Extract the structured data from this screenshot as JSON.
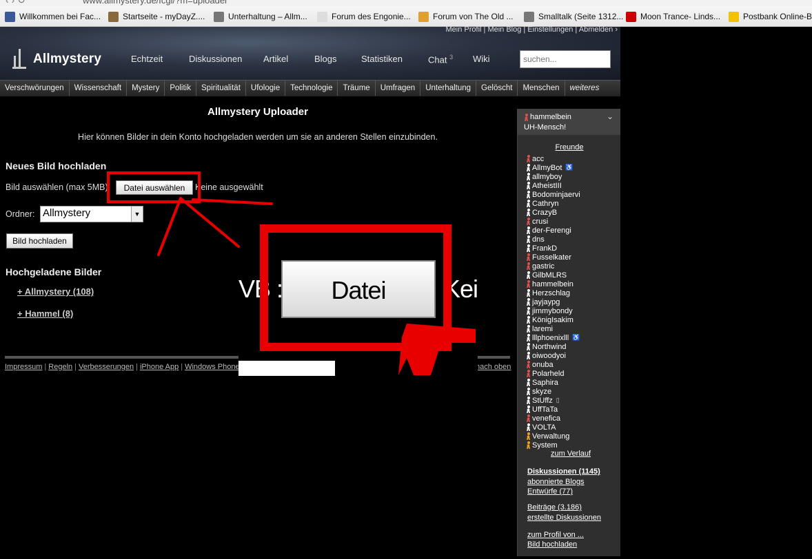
{
  "browser": {
    "url": "www.allmystery.de/fcgi/?m=uploader",
    "bookmarks": [
      {
        "label": "Willkommen bei Fac...",
        "color": "#3b5998"
      },
      {
        "label": "Startseite - myDayZ....",
        "color": "#8a6a3a"
      },
      {
        "label": "Unterhaltung – Allm...",
        "color": "#777777"
      },
      {
        "label": "Forum des Engonie...",
        "color": "#dddddd"
      },
      {
        "label": "Forum von The Old ...",
        "color": "#e0a030"
      },
      {
        "label": "Smalltalk (Seite 1312...",
        "color": "#777777"
      },
      {
        "label": "Moon Trance- Linds...",
        "color": "#cc0000"
      },
      {
        "label": "Postbank Online-B",
        "color": "#f2c200"
      }
    ]
  },
  "header": {
    "userlinks": "Mein Profil  |  Mein Blog  |  Einstellungen  |  Abmelden  ›",
    "logo": "Allmystery",
    "nav": [
      {
        "label": "Echtzeit"
      },
      {
        "label": "Diskussionen"
      },
      {
        "label": "Artikel"
      },
      {
        "label": "Blogs"
      },
      {
        "label": "Statistiken"
      },
      {
        "label": "Chat",
        "badge": "3"
      },
      {
        "label": "Wiki"
      }
    ],
    "search_placeholder": "suchen..."
  },
  "categories": [
    "Verschwörungen",
    "Wissenschaft",
    "Mystery",
    "Politik",
    "Spiritualität",
    "Ufologie",
    "Technologie",
    "Träume",
    "Umfragen",
    "Unterhaltung",
    "Gelöscht",
    "Menschen",
    "weiteres"
  ],
  "main": {
    "title": "Allmystery Uploader",
    "intro": "Hier können Bilder in dein Konto hochgeladen werden um sie an anderen Stellen einzubinden.",
    "new_image_heading": "Neues Bild hochladen",
    "choose_label": "Bild auswählen (max 5MB):",
    "choose_button": "Datei auswählen",
    "no_file": "Keine ausgewählt",
    "folder_label": "Ordner:",
    "folder_value": "Allmystery",
    "upload_button": "Bild hochladen",
    "uploaded_heading": "Hochgeladene Bilder",
    "folders": [
      "+ Allmystery (108)",
      "+ Hammel (8)"
    ]
  },
  "footer": {
    "links": [
      "Impressum",
      "Regeln",
      "Verbesserungen",
      "iPhone App",
      "Windows Phone A"
    ],
    "top_link": "nach oben"
  },
  "zoom": {
    "left_fragment": "VB :",
    "button": "Datei auswählen",
    "right_fragment": "Keine"
  },
  "sidebar": {
    "user": "hammelbein",
    "user_color": "#e05050",
    "status": "UH-Mensch!",
    "friends_title": "Freunde",
    "friends": [
      {
        "name": "acc",
        "color": "#e05050"
      },
      {
        "name": "AllmyBot",
        "color": "#ffffff",
        "extra": "♿"
      },
      {
        "name": "allmyboy",
        "color": "#ffffff"
      },
      {
        "name": "AtheistIII",
        "color": "#ffffff"
      },
      {
        "name": "Bodominjaervi",
        "color": "#ffffff"
      },
      {
        "name": "Cathryn",
        "color": "#ffffff"
      },
      {
        "name": "CrazyB",
        "color": "#ffffff"
      },
      {
        "name": "crusi",
        "color": "#e05050"
      },
      {
        "name": "der-Ferengi",
        "color": "#ffffff"
      },
      {
        "name": "dns",
        "color": "#ffffff"
      },
      {
        "name": "FrankD",
        "color": "#ffffff"
      },
      {
        "name": "Fusselkater",
        "color": "#e05050"
      },
      {
        "name": "gastric",
        "color": "#e05050"
      },
      {
        "name": "GilbMLRS",
        "color": "#ffffff"
      },
      {
        "name": "hammelbein",
        "color": "#e05050"
      },
      {
        "name": "Herzschlag",
        "color": "#ffffff"
      },
      {
        "name": "jayjaypg",
        "color": "#ffffff"
      },
      {
        "name": "jimmybondy",
        "color": "#ffffff"
      },
      {
        "name": "KönigIsakim",
        "color": "#ffffff"
      },
      {
        "name": "laremi",
        "color": "#ffffff"
      },
      {
        "name": "lllphoenixlll",
        "color": "#ffffff",
        "extra": "♿"
      },
      {
        "name": "Northwind",
        "color": "#ffffff"
      },
      {
        "name": "oiwoodyoi",
        "color": "#ffffff"
      },
      {
        "name": "onuba",
        "color": "#e05050"
      },
      {
        "name": "Polarheld",
        "color": "#e05050"
      },
      {
        "name": "Saphira",
        "color": "#ffffff"
      },
      {
        "name": "skyze",
        "color": "#ffffff"
      },
      {
        "name": "StUffz",
        "color": "#ffffff",
        "extra": "▯"
      },
      {
        "name": "UffTaTa",
        "color": "#ffffff"
      },
      {
        "name": "venefica",
        "color": "#e05050"
      },
      {
        "name": "VOLTA",
        "color": "#ffffff"
      },
      {
        "name": "Verwaltung",
        "color": "#f0a020"
      },
      {
        "name": "System",
        "color": "#f0a020"
      }
    ],
    "history_link": "zum Verlauf",
    "links": [
      {
        "label": "Diskussionen (1145)",
        "bold": true
      },
      {
        "label": "abonnierte Blogs"
      },
      {
        "label": "Entwürfe (77)"
      },
      {
        "label": "Beiträge (3.186)"
      },
      {
        "label": "erstellte Diskussionen"
      },
      {
        "label": "zum Profil von ..."
      },
      {
        "label": "Bild hochladen"
      }
    ]
  },
  "colors": {
    "annotation_red": "#e80000",
    "page_bg": "#000000",
    "sidebar_bg": "#2f2f2f"
  }
}
